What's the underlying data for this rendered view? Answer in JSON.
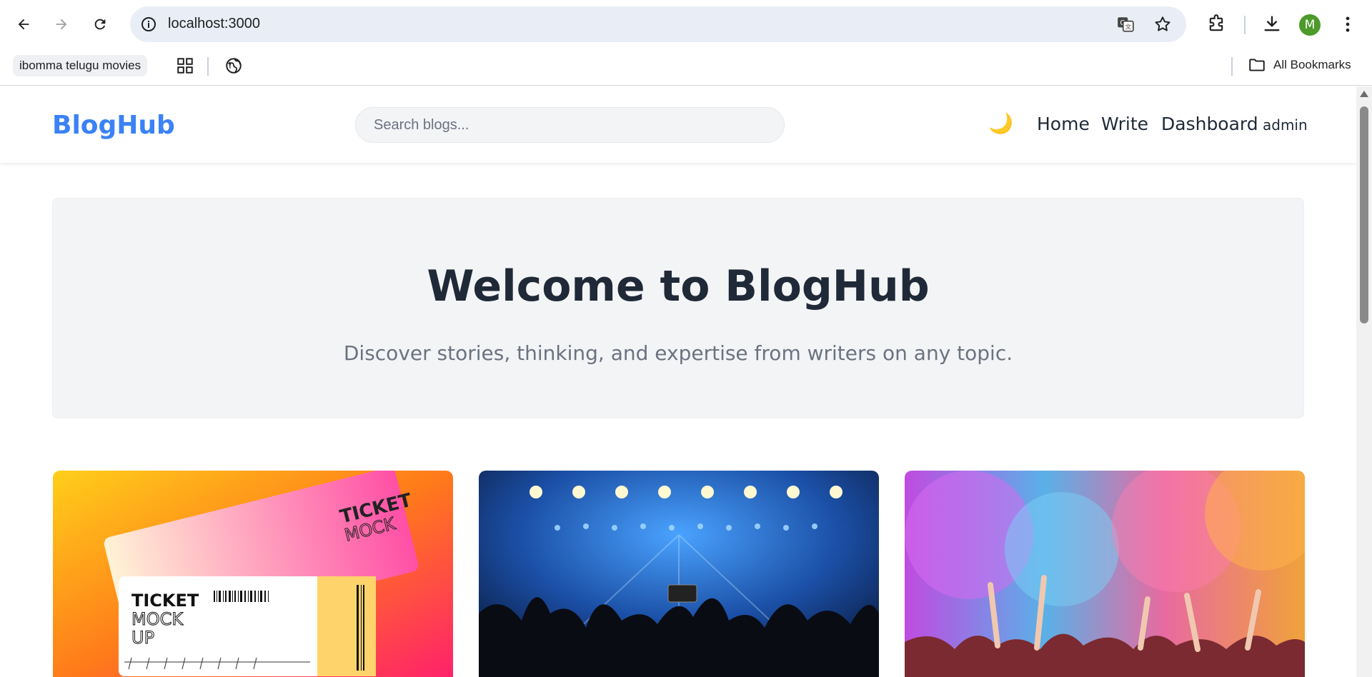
{
  "browser": {
    "url": "localhost:3000",
    "avatar_initial": "M",
    "bookmarks": {
      "first_label": "ibomma telugu movies",
      "all_label": "All Bookmarks"
    }
  },
  "site": {
    "brand": "BlogHub",
    "brand_color": "#3b82f6",
    "search_placeholder": "Search blogs...",
    "theme_toggle_icon": "🌙",
    "nav": {
      "home": "Home",
      "write": "Write",
      "dashboard": "Dashboard",
      "user": "admin"
    }
  },
  "hero": {
    "title": "Welcome to BlogHub",
    "subtitle": "Discover stories, thinking, and expertise from writers on any topic."
  },
  "cards": [
    {
      "image_icon": "ticket-mockup-image",
      "ticket_word": "TICKET",
      "mock_word": "MOCK",
      "up_word": "UP"
    },
    {
      "image_icon": "concert-crowd-image"
    },
    {
      "image_icon": "holi-color-festival-image"
    }
  ]
}
